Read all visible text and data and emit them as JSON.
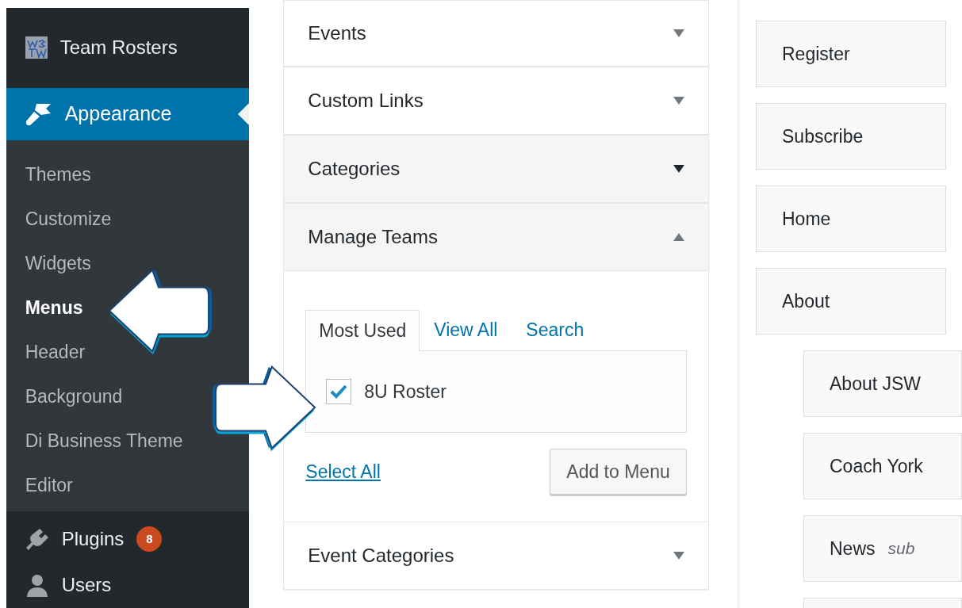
{
  "sidebar": {
    "site_name": "Team Rosters",
    "active_menu": "Appearance",
    "submenu": [
      {
        "label": "Themes",
        "selected": false
      },
      {
        "label": "Customize",
        "selected": false
      },
      {
        "label": "Widgets",
        "selected": false
      },
      {
        "label": "Menus",
        "selected": true
      },
      {
        "label": "Header",
        "selected": false
      },
      {
        "label": "Background",
        "selected": false
      },
      {
        "label": "Di Business Theme",
        "selected": false
      },
      {
        "label": "Editor",
        "selected": false
      }
    ],
    "menu": [
      {
        "label": "Plugins",
        "badge": "8"
      },
      {
        "label": "Users"
      }
    ]
  },
  "accordion": [
    {
      "title": "Events",
      "expanded": false,
      "hovered": false
    },
    {
      "title": "Custom Links",
      "expanded": false,
      "hovered": false
    },
    {
      "title": "Categories",
      "expanded": false,
      "hovered": true
    },
    {
      "title": "Manage Teams",
      "expanded": true,
      "hovered": false
    },
    {
      "title": "Event Categories",
      "expanded": false,
      "hovered": false
    }
  ],
  "manage_teams": {
    "tabs": [
      {
        "label": "Most Used",
        "selected": true
      },
      {
        "label": "View All",
        "selected": false
      },
      {
        "label": "Search",
        "selected": false
      }
    ],
    "items": [
      {
        "label": "8U Roster",
        "checked": true
      }
    ],
    "select_all": "Select All",
    "add_button": "Add to Menu"
  },
  "menu_structure": [
    {
      "label": "Register"
    },
    {
      "label": "Subscribe"
    },
    {
      "label": "Home"
    },
    {
      "label": "About",
      "children": [
        {
          "kind": "item",
          "label": "About JSW"
        },
        {
          "kind": "item",
          "label": "Coach York"
        },
        {
          "kind": "item",
          "label": "News",
          "note": "sub"
        },
        {
          "kind": "empty"
        }
      ]
    }
  ]
}
